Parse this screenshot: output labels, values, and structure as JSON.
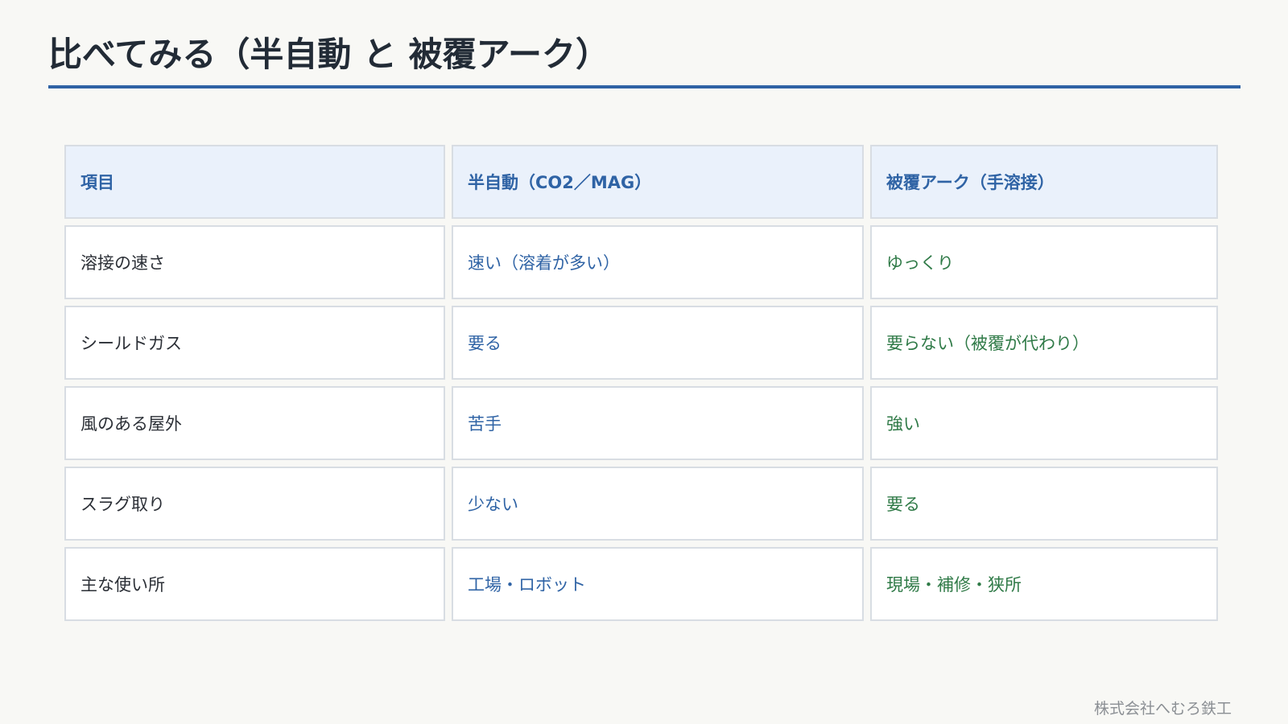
{
  "slide": {
    "title": "比べてみる（半自動 と 被覆アーク）",
    "footer": "株式会社へむろ鉄工"
  },
  "table": {
    "headers": [
      "項目",
      "半自動（CO2／MAG）",
      "被覆アーク（手溶接）"
    ],
    "rows": [
      [
        "溶接の速さ",
        "速い（溶着が多い）",
        "ゆっくり"
      ],
      [
        "シールドガス",
        "要る",
        "要らない（被覆が代わり）"
      ],
      [
        "風のある屋外",
        "苦手",
        "強い"
      ],
      [
        "スラグ取り",
        "少ない",
        "要る"
      ],
      [
        "主な使い所",
        "工場・ロボット",
        "現場・補修・狭所"
      ]
    ]
  },
  "colors": {
    "accent": "#2f63a5",
    "semi_auto_text": "#2f63a5",
    "coated_arc_text": "#2f7a47",
    "header_bg": "#eaf1fb"
  }
}
